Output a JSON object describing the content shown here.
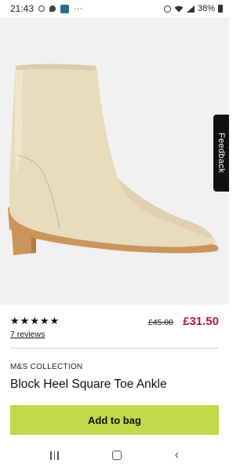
{
  "status_bar": {
    "time": "21:43",
    "icons_left": [
      "circle-icon",
      "chat-bubble-icon",
      "app-badge-icon",
      "more-dots-icon"
    ],
    "more": "···",
    "icons_right": [
      "alarm-icon",
      "wifi-icon",
      "signal-icon",
      "battery-icon"
    ],
    "battery_percent": "38%"
  },
  "product": {
    "image_name": "cream-block-heel-ankle-boot",
    "rating_stars": 5,
    "reviews_label": "7 reviews",
    "price_old": "£45.00",
    "price_new": "£31.50",
    "brand": "M&S COLLECTION",
    "title": "Block Heel Square Toe Ankle"
  },
  "feedback_tab": {
    "label": "Feedback"
  },
  "add_to_bag": {
    "label": "Add to bag"
  },
  "colors": {
    "price_sale": "#b01e35",
    "add_to_bag_bg": "#c2d94a",
    "boot": "#e8dcbd",
    "sole": "#c9955b"
  },
  "nav": [
    "recent-apps-icon",
    "home-icon",
    "back-icon"
  ]
}
